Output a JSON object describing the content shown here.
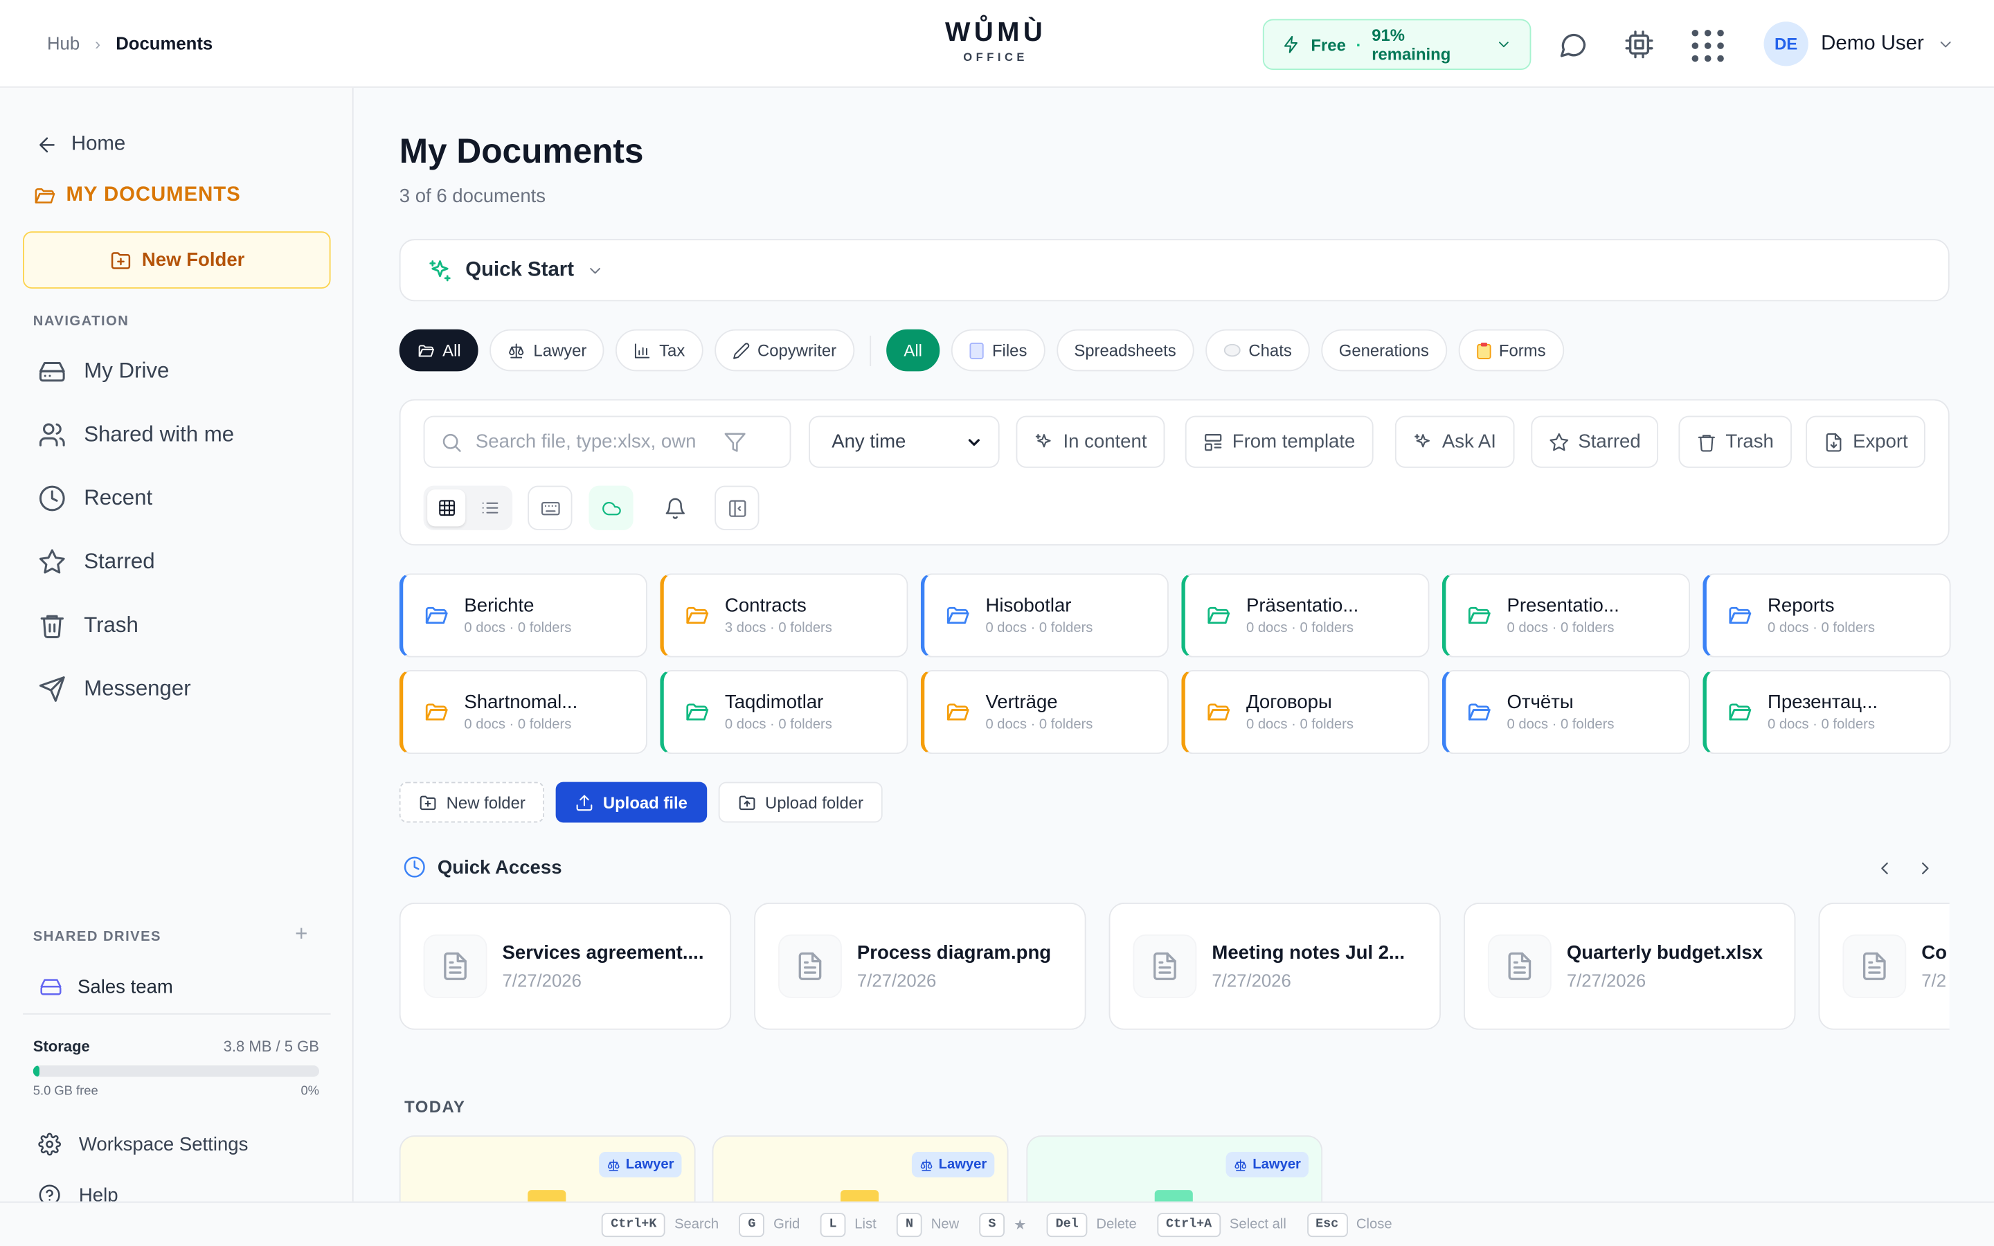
{
  "header": {
    "breadcrumb": [
      "Hub",
      "Documents"
    ],
    "logo_main": "WŮMÙ",
    "logo_sub": "OFFICE",
    "plan_name": "Free",
    "plan_sep": "·",
    "plan_status": "91% remaining",
    "user_initials": "DE",
    "user_name": "Demo User"
  },
  "sidebar": {
    "home": "Home",
    "my_documents": "MY DOCUMENTS",
    "new_folder": "New Folder",
    "nav_title": "NAVIGATION",
    "nav": [
      {
        "label": "My Drive",
        "icon": "drive-icon"
      },
      {
        "label": "Shared with me",
        "icon": "users-icon"
      },
      {
        "label": "Recent",
        "icon": "clock-icon"
      },
      {
        "label": "Starred",
        "icon": "star-icon"
      },
      {
        "label": "Trash",
        "icon": "trash-icon"
      },
      {
        "label": "Messenger",
        "icon": "send-icon"
      }
    ],
    "shared_title": "SHARED DRIVES",
    "shared_add": "+",
    "shared_drive": "Sales team",
    "storage": {
      "label": "Storage",
      "used": "3.8 MB / 5 GB",
      "free": "5.0 GB free",
      "percent_text": "0%",
      "fraction": 0.0008
    },
    "workspace_settings": "Workspace Settings",
    "help": "Help"
  },
  "main": {
    "title": "My Documents",
    "subtitle": "3 of 6 documents",
    "quick_start": "Quick Start",
    "role_chips": [
      "All",
      "Lawyer",
      "Tax",
      "Copywriter"
    ],
    "type_chips": [
      "All",
      "Files",
      "Spreadsheets",
      "Chats",
      "Generations",
      "Forms"
    ],
    "search_placeholder": "Search file, type:xlsx, own",
    "time_filter": "Any time",
    "tools": [
      "In content",
      "From template",
      "Ask AI",
      "Starred",
      "Trash",
      "Export"
    ],
    "folders": [
      {
        "name": "Berichte",
        "meta": "0 docs · 0 folders",
        "color": "#3b82f6"
      },
      {
        "name": "Contracts",
        "meta": "3 docs · 0 folders",
        "color": "#f59e0b"
      },
      {
        "name": "Hisobotlar",
        "meta": "0 docs · 0 folders",
        "color": "#3b82f6"
      },
      {
        "name": "Präsentatio...",
        "meta": "0 docs · 0 folders",
        "color": "#10b981"
      },
      {
        "name": "Presentatio...",
        "meta": "0 docs · 0 folders",
        "color": "#10b981"
      },
      {
        "name": "Reports",
        "meta": "0 docs · 0 folders",
        "color": "#3b82f6"
      },
      {
        "name": "Shartnomal...",
        "meta": "0 docs · 0 folders",
        "color": "#f59e0b"
      },
      {
        "name": "Taqdimotlar",
        "meta": "0 docs · 0 folders",
        "color": "#10b981"
      },
      {
        "name": "Verträge",
        "meta": "0 docs · 0 folders",
        "color": "#f59e0b"
      },
      {
        "name": "Договоры",
        "meta": "0 docs · 0 folders",
        "color": "#f59e0b"
      },
      {
        "name": "Отчёты",
        "meta": "0 docs · 0 folders",
        "color": "#3b82f6"
      },
      {
        "name": "Презентац...",
        "meta": "0 docs · 0 folders",
        "color": "#10b981"
      }
    ],
    "actions": [
      "New folder",
      "Upload file",
      "Upload folder"
    ],
    "quick_access_title": "Quick Access",
    "quick_access": [
      {
        "name": "Services agreement....",
        "date": "7/27/2026"
      },
      {
        "name": "Process diagram.png",
        "date": "7/27/2026"
      },
      {
        "name": "Meeting notes Jul 2...",
        "date": "7/27/2026"
      },
      {
        "name": "Quarterly budget.xlsx",
        "date": "7/27/2026"
      },
      {
        "name": "Co",
        "date": "7/2"
      }
    ],
    "today_title": "TODAY",
    "today_cards": [
      {
        "badge": "Lawyer",
        "bg": "#fefce8",
        "icon": "#fcd34d"
      },
      {
        "badge": "Lawyer",
        "bg": "#fefce8",
        "icon": "#fcd34d"
      },
      {
        "badge": "Lawyer",
        "bg": "#ecfdf5",
        "icon": "#6ee7b7"
      }
    ]
  },
  "shortcuts": [
    {
      "key": "Ctrl+K",
      "label": "Search"
    },
    {
      "key": "G",
      "label": "Grid"
    },
    {
      "key": "L",
      "label": "List"
    },
    {
      "key": "N",
      "label": "New"
    },
    {
      "key": "S",
      "label": "★"
    },
    {
      "key": "Del",
      "label": "Delete"
    },
    {
      "key": "Ctrl+A",
      "label": "Select all"
    },
    {
      "key": "Esc",
      "label": "Close"
    }
  ]
}
